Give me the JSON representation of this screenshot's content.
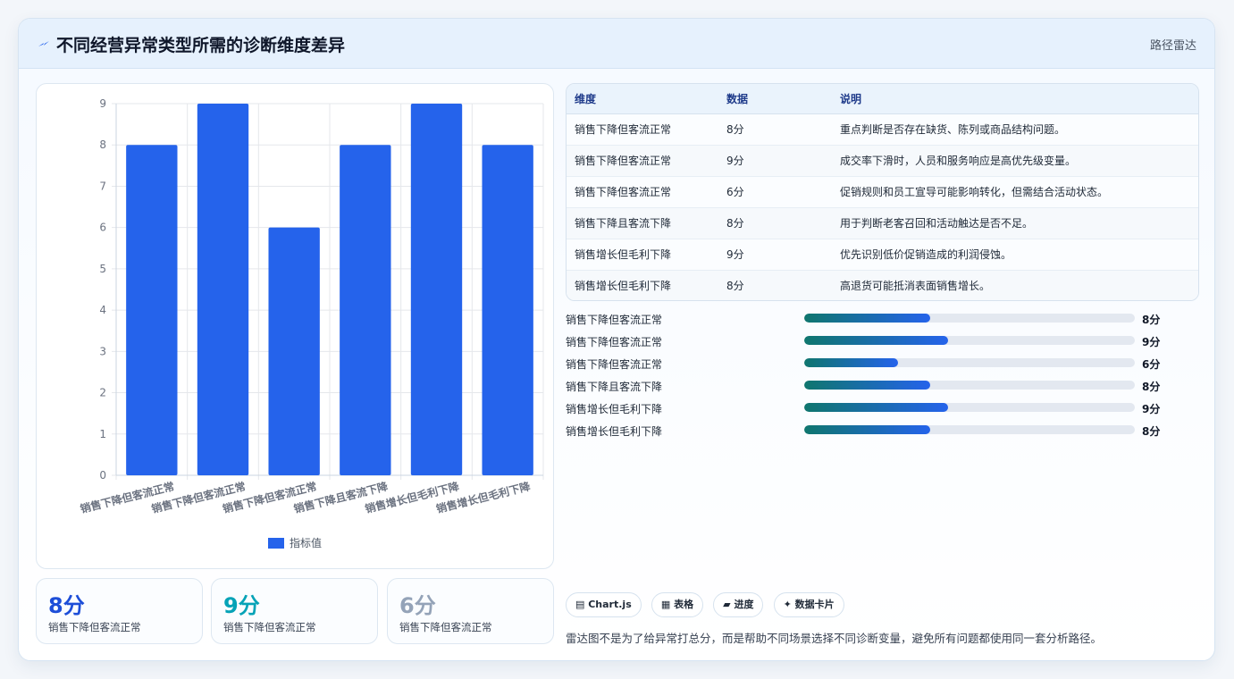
{
  "header": {
    "title": "不同经营异常类型所需的诊断维度差异",
    "tag": "路径雷达"
  },
  "chart_data": {
    "type": "bar",
    "categories": [
      "销售下降但客流正常",
      "销售下降但客流正常",
      "销售下降但客流正常",
      "销售下降且客流下降",
      "销售增长但毛利下降",
      "销售增长但毛利下降"
    ],
    "series": [
      {
        "name": "指标值",
        "values": [
          8,
          9,
          6,
          8,
          9,
          8
        ]
      }
    ],
    "ylim": [
      0,
      9
    ],
    "yticks": [
      0,
      1,
      2,
      3,
      4,
      5,
      6,
      7,
      8,
      9
    ],
    "grid": true,
    "legend": "bottom",
    "bar_color": "#2563eb"
  },
  "stats": [
    {
      "value": "8分",
      "label": "销售下降但客流正常",
      "color": "#1d4ed8"
    },
    {
      "value": "9分",
      "label": "销售下降但客流正常",
      "color": "#06a3b7"
    },
    {
      "value": "6分",
      "label": "销售下降但客流正常",
      "color": "#94a3b8"
    }
  ],
  "table": {
    "headers": [
      "维度",
      "数据",
      "说明"
    ],
    "rows": [
      [
        "销售下降但客流正常",
        "8分",
        "重点判断是否存在缺货、陈列或商品结构问题。"
      ],
      [
        "销售下降但客流正常",
        "9分",
        "成交率下滑时，人员和服务响应是高优先级变量。"
      ],
      [
        "销售下降但客流正常",
        "6分",
        "促销规则和员工宣导可能影响转化，但需结合活动状态。"
      ],
      [
        "销售下降且客流下降",
        "8分",
        "用于判断老客召回和活动触达是否不足。"
      ],
      [
        "销售增长但毛利下降",
        "9分",
        "优先识别低价促销造成的利润侵蚀。"
      ],
      [
        "销售增长但毛利下降",
        "8分",
        "高退货可能抵消表面销售增长。"
      ]
    ]
  },
  "progress": [
    {
      "label": "销售下降但客流正常",
      "value": "8分",
      "fraction": 0.38
    },
    {
      "label": "销售下降但客流正常",
      "value": "9分",
      "fraction": 0.435
    },
    {
      "label": "销售下降但客流正常",
      "value": "6分",
      "fraction": 0.285
    },
    {
      "label": "销售下降且客流下降",
      "value": "8分",
      "fraction": 0.38
    },
    {
      "label": "销售增长但毛利下降",
      "value": "9分",
      "fraction": 0.435
    },
    {
      "label": "销售增长但毛利下降",
      "value": "8分",
      "fraction": 0.38
    }
  ],
  "chips": [
    "Chart.js",
    "表格",
    "进度",
    "数据卡片"
  ],
  "chip_icons": [
    "chart-icon",
    "table-icon",
    "progress-icon",
    "card-icon"
  ],
  "note": "雷达图不是为了给异常打总分，而是帮助不同场景选择不同诊断变量，避免所有问题都使用同一套分析路径。"
}
